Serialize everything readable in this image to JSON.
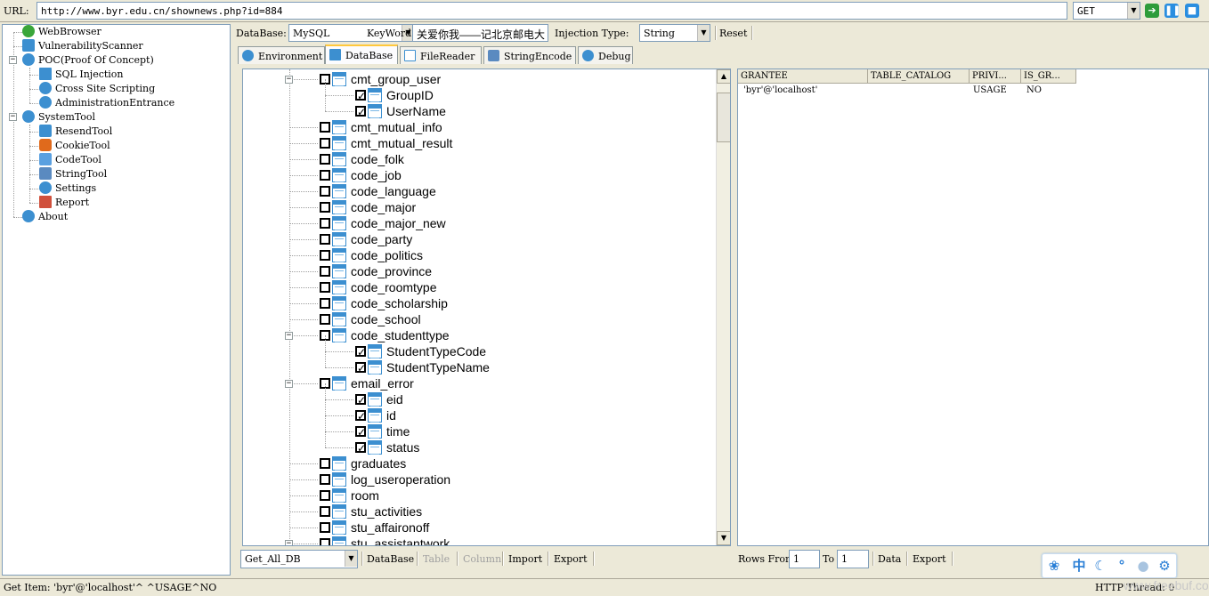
{
  "urlbar": {
    "label": "URL:",
    "url": "http://www.byr.edu.cn/shownews.php?id=884",
    "method": "GET"
  },
  "left_tree": {
    "items": [
      {
        "label": "WebBrowser",
        "icon": "check-circle-icon",
        "color": "#3aa63a"
      },
      {
        "label": "VulnerabilityScanner",
        "icon": "scanner-icon",
        "color": "#3c8fd0"
      },
      {
        "label": "POC(Proof Of Concept)",
        "icon": "gear-icon",
        "color": "#3c8fd0"
      },
      {
        "label": "SQL Injection",
        "icon": "table-icon",
        "color": "#3c8fd0"
      },
      {
        "label": "Cross Site Scripting",
        "icon": "globe-icon",
        "color": "#3c8fd0"
      },
      {
        "label": "AdministrationEntrance",
        "icon": "user-icon",
        "color": "#3c8fd0"
      },
      {
        "label": "SystemTool",
        "icon": "gear-icon",
        "color": "#3c8fd0"
      },
      {
        "label": "ResendTool",
        "icon": "resend-icon",
        "color": "#3c8fd0"
      },
      {
        "label": "CookieTool",
        "icon": "cookie-icon",
        "color": "#e06a1c"
      },
      {
        "label": "CodeTool",
        "icon": "monitor-icon",
        "color": "#5aa0e0"
      },
      {
        "label": "StringTool",
        "icon": "puzzle-icon",
        "color": "#5a8ac0"
      },
      {
        "label": "Settings",
        "icon": "gear-icon",
        "color": "#3c8fd0"
      },
      {
        "label": "Report",
        "icon": "bar-chart-icon",
        "color": "#d0503c"
      },
      {
        "label": "About",
        "icon": "help-icon",
        "color": "#3c8fd0"
      }
    ]
  },
  "options": {
    "database_label": "DataBase:",
    "database_value": "MySQL",
    "keyword_label": "KeyWord:",
    "keyword_value": "关爱你我——记北京邮电大",
    "injection_label": "Injection Type:",
    "injection_value": "String",
    "reset_label": "Reset"
  },
  "tabs": [
    {
      "label": "Environment",
      "icon": "info-icon"
    },
    {
      "label": "DataBase",
      "icon": "database-icon",
      "active": true
    },
    {
      "label": "FileReader",
      "icon": "file-icon"
    },
    {
      "label": "StringEncode",
      "icon": "puzzle-icon"
    },
    {
      "label": "Debug",
      "icon": "gear-icon"
    }
  ],
  "db_tree": {
    "rows": [
      {
        "label": "cmt_group_user",
        "level": 1,
        "checked": false,
        "expanded": true
      },
      {
        "label": "GroupID",
        "level": 2,
        "checked": true
      },
      {
        "label": "UserName",
        "level": 2,
        "checked": true
      },
      {
        "label": "cmt_mutual_info",
        "level": 1,
        "checked": false
      },
      {
        "label": "cmt_mutual_result",
        "level": 1,
        "checked": false
      },
      {
        "label": "code_folk",
        "level": 1,
        "checked": false
      },
      {
        "label": "code_job",
        "level": 1,
        "checked": false
      },
      {
        "label": "code_language",
        "level": 1,
        "checked": false
      },
      {
        "label": "code_major",
        "level": 1,
        "checked": false
      },
      {
        "label": "code_major_new",
        "level": 1,
        "checked": false
      },
      {
        "label": "code_party",
        "level": 1,
        "checked": false
      },
      {
        "label": "code_politics",
        "level": 1,
        "checked": false
      },
      {
        "label": "code_province",
        "level": 1,
        "checked": false
      },
      {
        "label": "code_roomtype",
        "level": 1,
        "checked": false
      },
      {
        "label": "code_scholarship",
        "level": 1,
        "checked": false
      },
      {
        "label": "code_school",
        "level": 1,
        "checked": false
      },
      {
        "label": "code_studenttype",
        "level": 1,
        "checked": false,
        "expanded": true
      },
      {
        "label": "StudentTypeCode",
        "level": 2,
        "checked": true
      },
      {
        "label": "StudentTypeName",
        "level": 2,
        "checked": true
      },
      {
        "label": "email_error",
        "level": 1,
        "checked": false,
        "expanded": true
      },
      {
        "label": "eid",
        "level": 2,
        "checked": true
      },
      {
        "label": "id",
        "level": 2,
        "checked": true
      },
      {
        "label": "time",
        "level": 2,
        "checked": true
      },
      {
        "label": "status",
        "level": 2,
        "checked": true
      },
      {
        "label": "graduates",
        "level": 1,
        "checked": false
      },
      {
        "label": "log_useroperation",
        "level": 1,
        "checked": false
      },
      {
        "label": "room",
        "level": 1,
        "checked": false
      },
      {
        "label": "stu_activities",
        "level": 1,
        "checked": false
      },
      {
        "label": "stu_affaironoff",
        "level": 1,
        "checked": false
      },
      {
        "label": "stu_assistantwork",
        "level": 1,
        "checked": false,
        "expanded": true
      }
    ]
  },
  "grid": {
    "columns": [
      "GRANTEE",
      "TABLE_CATALOG",
      "PRIVI...",
      "IS_GR..."
    ],
    "rows": [
      [
        "'byr'@'localhost'",
        "",
        "USAGE",
        "NO"
      ]
    ]
  },
  "db_bottom": {
    "mode_value": "Get_All_DB",
    "database_btn": "DataBase",
    "table_btn": "Table",
    "column_btn": "Column",
    "import_btn": "Import",
    "export_btn": "Export"
  },
  "grid_bottom": {
    "rows_from_label": "Rows From",
    "rows_from_value": "1",
    "to_label": "To",
    "to_value": "1",
    "data_btn": "Data",
    "export_btn": "Export"
  },
  "status": {
    "text": "Get Item: 'byr'@'localhost'^ ^USAGE^NO",
    "right": "HTTP Thread: 0"
  },
  "watermark": "www.freebuf.com"
}
